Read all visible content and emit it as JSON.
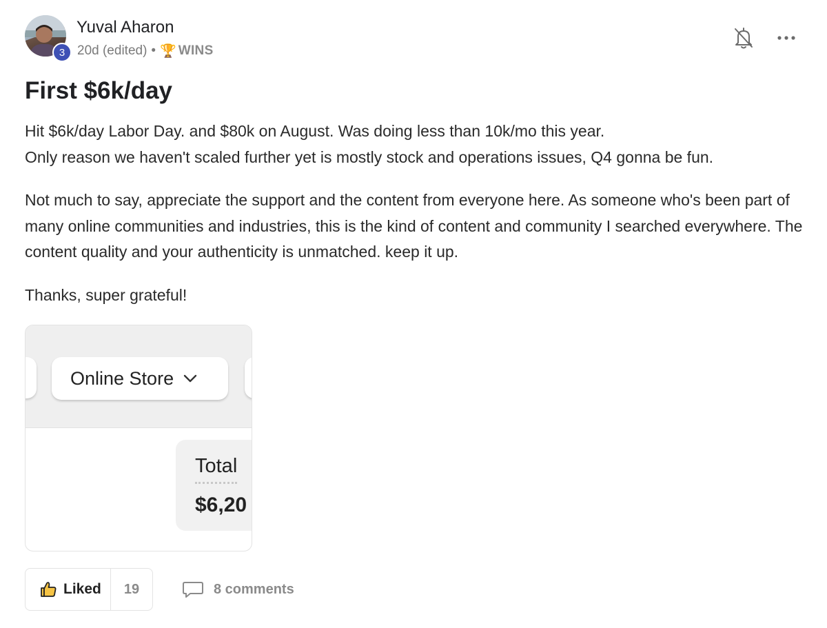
{
  "author": {
    "name": "Yuval Aharon",
    "level": "3"
  },
  "meta": {
    "time": "20d (edited)",
    "separator": "•",
    "category_icon": "trophy-icon",
    "category_emoji": "🏆",
    "category": "WINS"
  },
  "header_actions": {
    "bell_icon": "bell-off-icon",
    "more_icon": "more-horizontal-icon"
  },
  "post": {
    "title": "First $6k/day",
    "paragraphs": [
      "Hit $6k/day Labor Day. and $80k on August. Was doing less than 10k/mo this year.",
      "Only reason we haven't scaled further yet is mostly stock and operations issues, Q4 gonna be fun.",
      "Not much to say, appreciate the support and the content from everyone here. As someone who's been part of many online communities and industries, this is the kind of content and community I searched everywhere. The content quality and your authenticity is unmatched. keep it up.",
      "Thanks, super grateful!"
    ]
  },
  "attachment": {
    "dropdown_label": "Online Store",
    "dropdown_icon": "chevron-down-icon",
    "total_label": "Total",
    "total_value": "$6,20"
  },
  "actions": {
    "like_label": "Liked",
    "like_icon": "thumbs-up-icon",
    "like_count": "19",
    "comment_icon": "comment-icon",
    "comments_label": "8 comments"
  },
  "colors": {
    "level_badge": "#3f51b5",
    "like_icon_fill": "#f6c445",
    "muted_text": "#7a7a7a"
  }
}
